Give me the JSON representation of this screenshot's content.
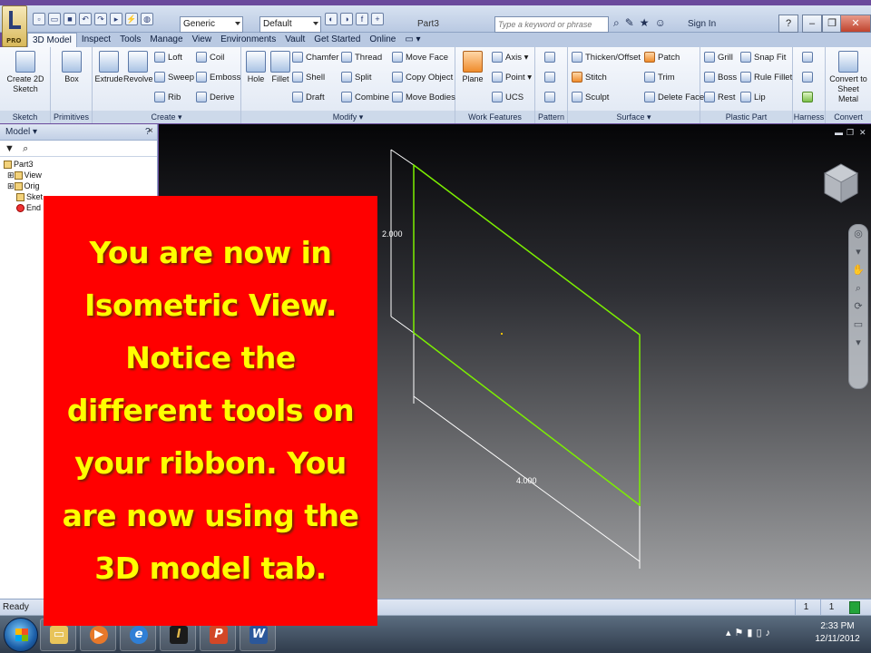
{
  "app": {
    "logo_label": "PRO",
    "material_dropdown": "Generic",
    "appearance_dropdown": "Default",
    "document_title": "Part3",
    "search_placeholder": "Type a keyword or phrase",
    "signin_label": "Sign In"
  },
  "tabs": [
    "3D Model",
    "Inspect",
    "Tools",
    "Manage",
    "View",
    "Environments",
    "Vault",
    "Get Started",
    "Online"
  ],
  "active_tab": "3D Model",
  "ribbon": {
    "sketch": {
      "label": "Sketch",
      "create_2d_sketch": "Create 2D Sketch"
    },
    "primitives": {
      "label": "Primitives",
      "box": "Box"
    },
    "create": {
      "label": "Create",
      "extrude": "Extrude",
      "revolve": "Revolve",
      "loft": "Loft",
      "sweep": "Sweep",
      "rib": "Rib",
      "coil": "Coil",
      "emboss": "Emboss",
      "derive": "Derive"
    },
    "modify": {
      "label": "Modify",
      "hole": "Hole",
      "fillet": "Fillet",
      "chamfer": "Chamfer",
      "shell": "Shell",
      "draft": "Draft",
      "thread": "Thread",
      "split": "Split",
      "combine": "Combine",
      "move_face": "Move Face",
      "copy_object": "Copy Object",
      "move_bodies": "Move Bodies"
    },
    "work_features": {
      "label": "Work Features",
      "plane": "Plane",
      "axis": "Axis",
      "point": "Point",
      "ucs": "UCS"
    },
    "pattern": {
      "label": "Pattern"
    },
    "surface": {
      "label": "Surface",
      "thicken_offset": "Thicken/Offset",
      "stitch": "Stitch",
      "sculpt": "Sculpt",
      "patch": "Patch",
      "trim": "Trim",
      "delete_face": "Delete Face"
    },
    "plastic_part": {
      "label": "Plastic Part",
      "grill": "Grill",
      "boss": "Boss",
      "rest": "Rest",
      "snap_fit": "Snap Fit",
      "rule_fillet": "Rule Fillet",
      "lip": "Lip"
    },
    "harness": {
      "label": "Harness"
    },
    "convert": {
      "label": "Convert",
      "convert_to_sheet_metal": "Convert to Sheet Metal"
    }
  },
  "browser": {
    "title": "Model",
    "tree": [
      "Part3",
      "View",
      "Orig",
      "Sket",
      "End"
    ]
  },
  "viewport": {
    "dim_height": "2.000",
    "dim_width": "4.000",
    "sketch_color": "#7cf000"
  },
  "status": {
    "text": "Ready",
    "count_a": "1",
    "count_b": "1"
  },
  "taskbar": {
    "time": "2:33 PM",
    "date": "12/11/2012"
  },
  "callout": {
    "text": "You are now in Isometric View. Notice the different tools on your ribbon. You are now using the 3D model tab.",
    "bg_color": "#ff0000",
    "text_color": "#ffff00"
  }
}
